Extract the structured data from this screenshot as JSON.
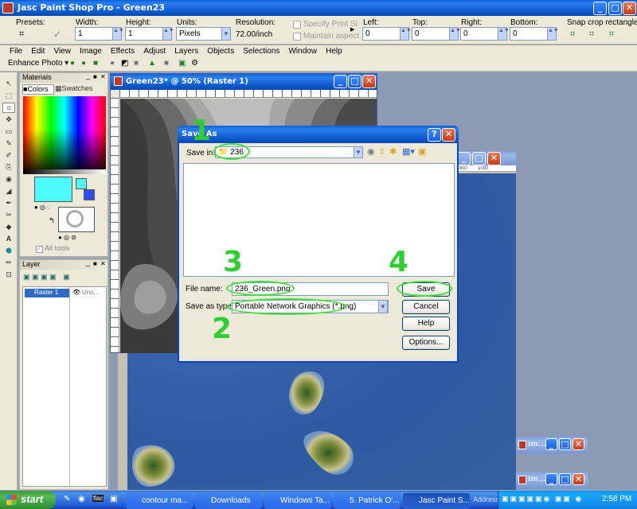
{
  "app": {
    "title": "Jasc Paint Shop Pro - Green23",
    "menu": [
      "File",
      "Edit",
      "View",
      "Image",
      "Effects",
      "Adjust",
      "Layers",
      "Objects",
      "Selections",
      "Window",
      "Help"
    ],
    "enhance_label": "Enhance Photo"
  },
  "options_bar": {
    "presets_label": "Presets:",
    "width_label": "Width:",
    "width_value": "1",
    "height_label": "Height:",
    "height_value": "1",
    "units_label": "Units:",
    "units_value": "Pixels",
    "resolution_label": "Resolution:",
    "resolution_value": "72.00/inch",
    "specify_print_label": "Specify Print Si",
    "maintain_aspect_label": "Maintain aspect",
    "left_label": "Left:",
    "left_value": "0",
    "top_label": "Top:",
    "top_value": "0",
    "right_label": "Right:",
    "right_value": "0",
    "bottom_label": "Bottom:",
    "bottom_value": "0",
    "snap_label": "Snap crop rectangle to:"
  },
  "materials": {
    "title": "Materials",
    "tabs": [
      "Colors",
      "Swatches"
    ],
    "all_tools_label": "All tools"
  },
  "layers": {
    "title": "Layer",
    "row_name": "Raster 1",
    "row_extra": "Uno..."
  },
  "image_window": {
    "title": "Green23* @  50% (Raster 1)"
  },
  "save_dialog": {
    "title": "Save As",
    "save_in_label": "Save in:",
    "save_in_value": "236",
    "file_name_label": "File name:",
    "file_name_value": "236_Green.png",
    "save_type_label": "Save as type:",
    "save_type_value": "Portable Network Graphics (*.png)",
    "buttons": {
      "save": "Save",
      "cancel": "Cancel",
      "help": "Help",
      "options": "Options..."
    }
  },
  "annotations": [
    "1",
    "2",
    "3",
    "4"
  ],
  "mini_windows": [
    "Im...",
    "Im..."
  ],
  "taskbar": {
    "start": "start",
    "tasks": [
      "contour ma...",
      "Downloads",
      "Windows Ta...",
      "5. Patrick O'...",
      "Jasc Paint S..."
    ],
    "address_label": "Address",
    "clock": "2:58 PM"
  },
  "colors": {
    "accent_green": "#3fe03f",
    "title_blue": "#0a5fd9",
    "ocean": "#3a63a8",
    "foreground_swatch": "#4cfcfc",
    "background_swatch": "#2f4cf0"
  }
}
